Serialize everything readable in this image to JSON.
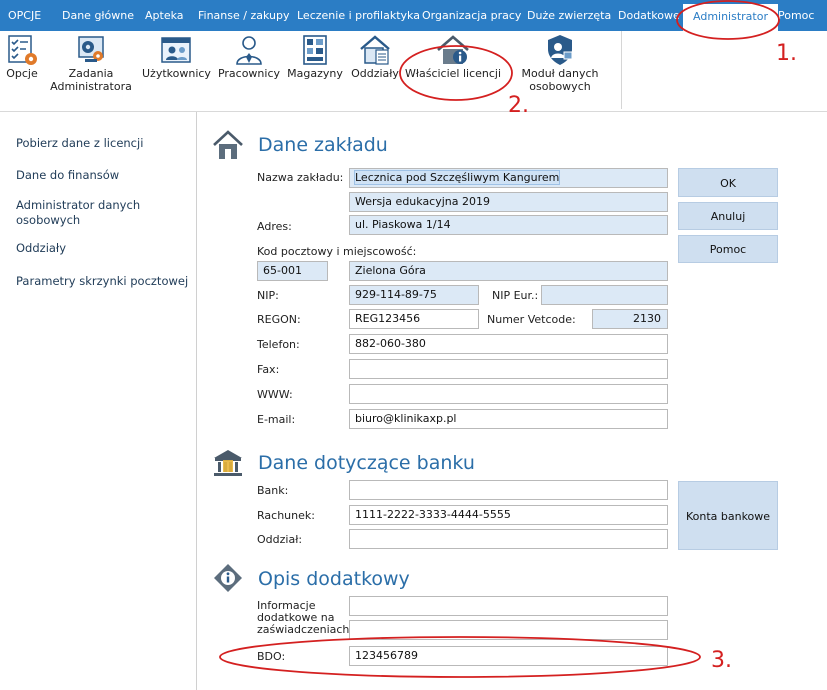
{
  "tabs": [
    {
      "label": "OPCJE"
    },
    {
      "label": "Dane główne"
    },
    {
      "label": "Apteka"
    },
    {
      "label": "Finanse / zakupy"
    },
    {
      "label": "Leczenie i profilaktyka"
    },
    {
      "label": "Organizacja pracy"
    },
    {
      "label": "Duże zwierzęta"
    },
    {
      "label": "Dodatkowe"
    },
    {
      "label": "Administrator"
    },
    {
      "label": "Pomoc"
    }
  ],
  "ribbon": {
    "opcje": "Opcje",
    "zadania_1": "Zadania",
    "zadania_2": "Administratora",
    "uzytkownicy": "Użytkownicy",
    "pracownicy": "Pracownicy",
    "magazyny": "Magazyny",
    "oddzialy": "Oddziały",
    "wlasciciel": "Właściciel licencji",
    "modul_1": "Moduł danych",
    "modul_2": "osobowych"
  },
  "sidebar": [
    {
      "label": "Pobierz dane z licencji"
    },
    {
      "label": "Dane do finansów"
    },
    {
      "label": "Administrator danych osobowych"
    },
    {
      "label": "Oddziały"
    },
    {
      "label": "Parametry skrzynki pocztowej"
    }
  ],
  "sections": {
    "zaklad": "Dane zakładu",
    "bank": "Dane dotyczące banku",
    "opis": "Opis dodatkowy"
  },
  "form": {
    "nazwa_label": "Nazwa zakładu:",
    "nazwa_1": "Lecznica pod Szczęśliwym Kangurem",
    "nazwa_2": "Wersja edukacyjna 2019",
    "adres_label": "Adres:",
    "adres": "ul. Piaskowa 1/14",
    "kod_label": "Kod pocztowy i miejscowość:",
    "kod": "65-001",
    "miasto": "Zielona Góra",
    "nip_label": "NIP:",
    "nip": "929-114-89-75",
    "nip_eur_label": "NIP Eur.:",
    "nip_eur": "",
    "regon_label": "REGON:",
    "regon": "REG123456",
    "vetcode_label": "Numer Vetcode:",
    "vetcode": "2130",
    "telefon_label": "Telefon:",
    "telefon": "882-060-380",
    "fax_label": "Fax:",
    "fax": "",
    "www_label": "WWW:",
    "www": "",
    "email_label": "E-mail:",
    "email": "biuro@klinikaxp.pl",
    "bank_label": "Bank:",
    "bank": "",
    "rachunek_label": "Rachunek:",
    "rachunek": "1111-2222-3333-4444-5555",
    "oddzial_label": "Oddział:",
    "oddzial": "",
    "info_label_1": "Informacje",
    "info_label_2": "dodatkowe na",
    "info_label_3": "zaświadczeniach:",
    "info": "",
    "bdo_label": "BDO:",
    "bdo": "123456789"
  },
  "buttons": {
    "ok": "OK",
    "anuluj": "Anuluj",
    "pomoc": "Pomoc",
    "konta": "Konta bankowe"
  },
  "annotations": {
    "n1": "1.",
    "n2": "2.",
    "n3": "3."
  },
  "colors": {
    "accent": "#2b7dc5",
    "annotation": "#d42020"
  }
}
